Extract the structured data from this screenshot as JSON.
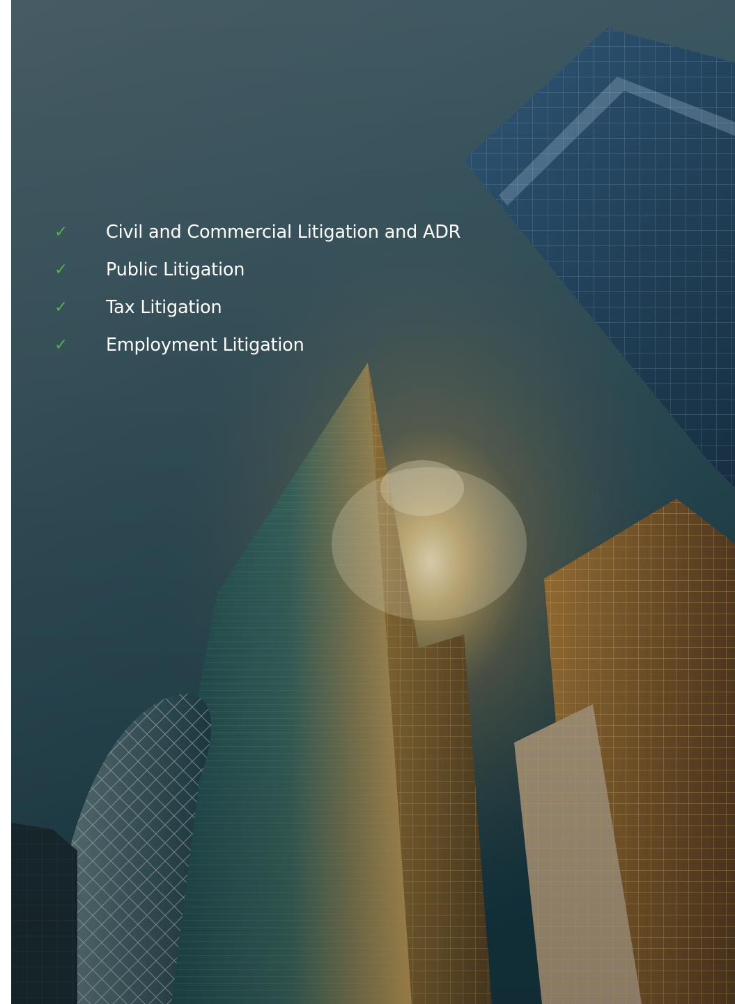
{
  "colors": {
    "check": "#4fb24a",
    "text": "#ffffff",
    "sky_top": "#3d5560",
    "sky_bottom": "#18404c"
  },
  "services": {
    "items": [
      {
        "icon": "check-icon",
        "label": "Civil and Commercial Litigation and ADR"
      },
      {
        "icon": "check-icon",
        "label": "Public Litigation"
      },
      {
        "icon": "check-icon",
        "label": "Tax Litigation"
      },
      {
        "icon": "check-icon",
        "label": "Employment Litigation"
      }
    ]
  }
}
